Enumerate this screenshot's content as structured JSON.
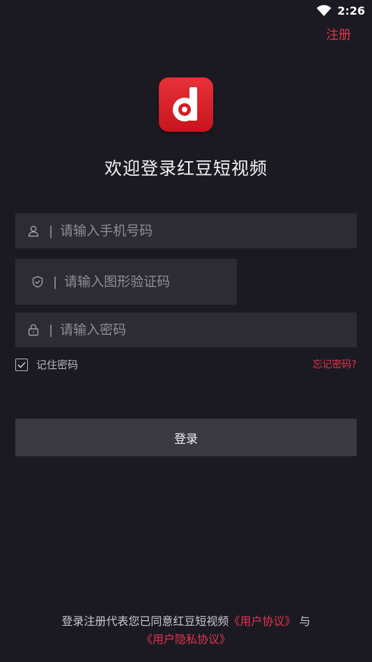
{
  "status_bar": {
    "time": "2:26",
    "icons": [
      "wifi-icon"
    ]
  },
  "header": {
    "register_label": "注册"
  },
  "logo": {
    "letter": "d",
    "colors": {
      "bg_top": "#e8323a",
      "bg_bottom": "#c8141d"
    }
  },
  "welcome": {
    "title": "欢迎登录红豆短视频"
  },
  "form": {
    "phone": {
      "icon": "user-icon",
      "separator": "|",
      "placeholder": "请输入手机号码",
      "value": ""
    },
    "captcha": {
      "icon": "shield-icon",
      "separator": "|",
      "placeholder": "请输入图形验证码",
      "value": ""
    },
    "password": {
      "icon": "lock-icon",
      "separator": "|",
      "placeholder": "请输入密码",
      "value": ""
    },
    "remember_label": "记住密码",
    "remember_checked": true,
    "forgot_label": "忘记密码?",
    "login_label": "登录"
  },
  "agreement": {
    "prefix": "登录注册代表您已同意红豆短视频",
    "user_agreement": "《用户协议》",
    "joiner": "与",
    "privacy_agreement": "《用户隐私协议》"
  },
  "colors": {
    "accent": "#e8334d",
    "background": "#1b1a22",
    "input_bg": "#2d2c35",
    "button_bg": "#3a3942"
  }
}
